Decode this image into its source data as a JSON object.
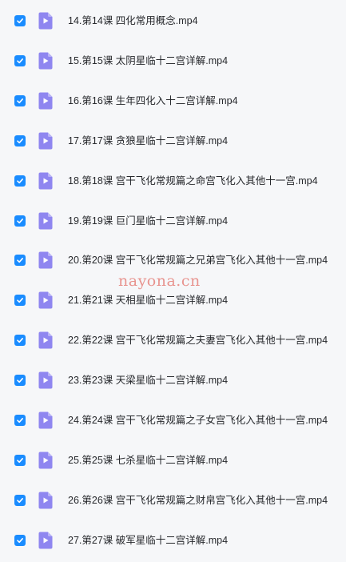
{
  "files": [
    {
      "name": "14.第14课 四化常用概念.mp4",
      "checked": true,
      "icon": "video-file-icon"
    },
    {
      "name": "15.第15课 太阴星临十二宫详解.mp4",
      "checked": true,
      "icon": "video-file-icon"
    },
    {
      "name": "16.第16课 生年四化入十二宫详解.mp4",
      "checked": true,
      "icon": "video-file-icon"
    },
    {
      "name": "17.第17课 贪狼星临十二宫详解.mp4",
      "checked": true,
      "icon": "video-file-icon"
    },
    {
      "name": "18.第18课 宫干飞化常规篇之命宫飞化入其他十一宫.mp4",
      "checked": true,
      "icon": "video-file-icon"
    },
    {
      "name": "19.第19课 巨门星临十二宫详解.mp4",
      "checked": true,
      "icon": "video-file-icon"
    },
    {
      "name": "20.第20课 宫干飞化常规篇之兄弟宫飞化入其他十一宫.mp4",
      "checked": true,
      "icon": "video-file-icon"
    },
    {
      "name": "21.第21课 天相星临十二宫详解.mp4",
      "checked": true,
      "icon": "video-file-icon"
    },
    {
      "name": "22.第22课 宫干飞化常规篇之夫妻宫飞化入其他十一宫.mp4",
      "checked": true,
      "icon": "video-file-icon"
    },
    {
      "name": "23.第23课 天梁星临十二宫详解.mp4",
      "checked": true,
      "icon": "video-file-icon"
    },
    {
      "name": "24.第24课 宫干飞化常规篇之子女宫飞化入其他十一宫.mp4",
      "checked": true,
      "icon": "video-file-icon"
    },
    {
      "name": "25.第25课 七杀星临十二宫详解.mp4",
      "checked": true,
      "icon": "video-file-icon"
    },
    {
      "name": "26.第26课 宫干飞化常规篇之财帛宫飞化入其他十一宫.mp4",
      "checked": true,
      "icon": "video-file-icon"
    },
    {
      "name": "27.第27课 破军星临十二宫详解.mp4",
      "checked": true,
      "icon": "video-file-icon"
    }
  ],
  "watermark": "nayona.cn",
  "colors": {
    "checkbox": "#1a8cff",
    "file_icon": "#8f86f0",
    "text": "#26282c",
    "background": "#f6f7f9",
    "watermark": "#e8948f"
  }
}
